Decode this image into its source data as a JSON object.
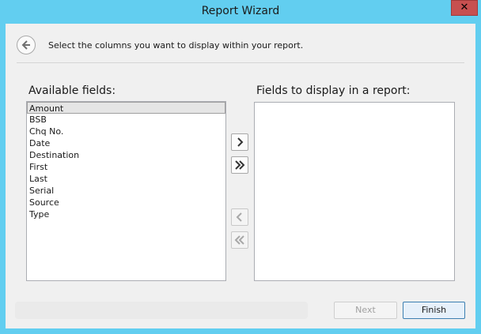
{
  "window": {
    "title": "Report Wizard",
    "close_glyph": "✕"
  },
  "header": {
    "instruction": "Select the columns you want to display within your report.",
    "back_icon": "back-arrow-icon"
  },
  "available": {
    "label": "Available fields:",
    "items": [
      "Amount",
      "BSB",
      "Chq No.",
      "Date",
      "Destination",
      "First",
      "Last",
      "Serial",
      "Source",
      "Type"
    ],
    "selected": "Amount"
  },
  "display": {
    "label": "Fields to display in a report:",
    "items": []
  },
  "move_buttons": {
    "add_one_icon": "chevron-right-icon",
    "add_all_icon": "double-chevron-right-icon",
    "remove_one_icon": "chevron-left-icon",
    "remove_all_icon": "double-chevron-left-icon"
  },
  "footer": {
    "next_label": "Next",
    "finish_label": "Finish"
  },
  "colors": {
    "frame": "#62cef0",
    "client": "#f0f0f0",
    "close": "#c75050",
    "accent": "#3c7fb1"
  }
}
